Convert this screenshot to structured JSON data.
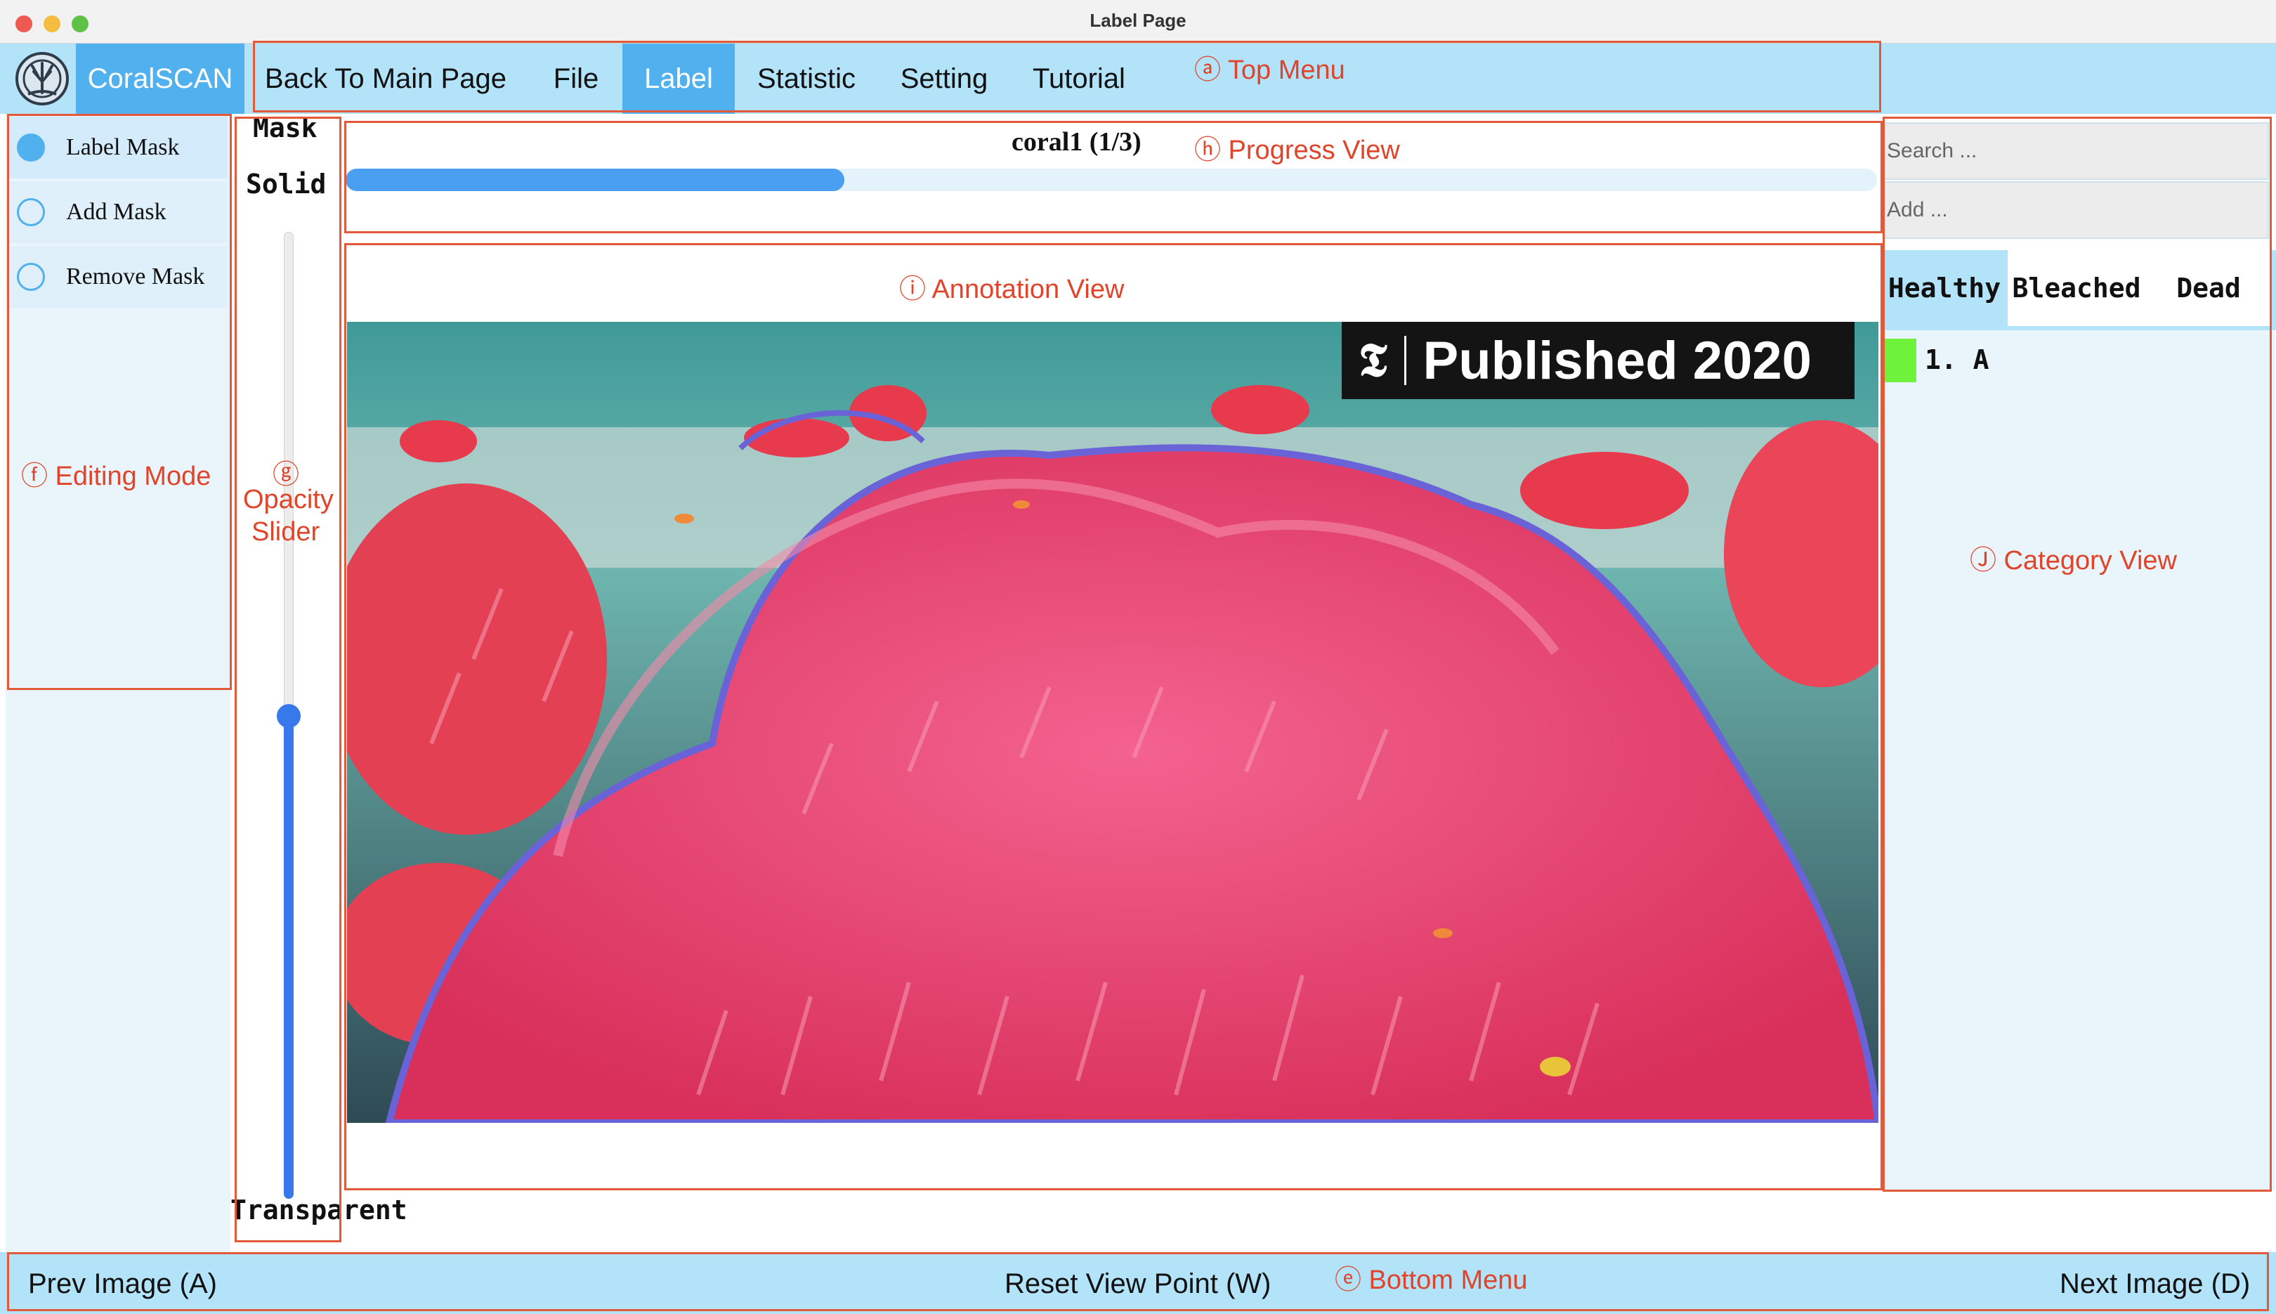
{
  "window": {
    "title": "Label Page",
    "traffic_lights": [
      "#ee5a52",
      "#f5bd3f",
      "#5fc146"
    ]
  },
  "top_menu": {
    "brand": "CoralSCAN",
    "items": [
      {
        "label": "Back To Main Page",
        "active": false
      },
      {
        "label": "File",
        "active": false
      },
      {
        "label": "Label",
        "active": true
      },
      {
        "label": "Statistic",
        "active": false
      },
      {
        "label": "Setting",
        "active": false
      },
      {
        "label": "Tutorial",
        "active": false
      }
    ]
  },
  "editing_mode": {
    "options": [
      {
        "label": "Label Mask",
        "selected": true
      },
      {
        "label": "Add Mask",
        "selected": false
      },
      {
        "label": "Remove Mask",
        "selected": false
      }
    ]
  },
  "opacity_slider": {
    "title": "Mask",
    "top_label": "Solid",
    "bottom_label": "Transparent",
    "value": 0.5
  },
  "progress": {
    "text": "coral1 (1/3)",
    "fraction": 0.333
  },
  "image": {
    "watermark_logo": "𝕿",
    "watermark_text": "Published 2020"
  },
  "category_view": {
    "search_placeholder": "Search ...",
    "add_placeholder": "Add ...",
    "tabs": [
      {
        "label": "Healthy",
        "active": false
      },
      {
        "label": "Bleached",
        "active": true
      },
      {
        "label": "Dead",
        "active": true
      }
    ],
    "items": [
      {
        "label": "1. A",
        "color": "#6ef23b"
      }
    ]
  },
  "bottom_menu": {
    "prev": "Prev Image (A)",
    "reset": "Reset View Point (W)",
    "next": "Next Image (D)"
  },
  "annotations": {
    "a": "ⓐ Top Menu",
    "e": "ⓔ Bottom Menu",
    "f": "ⓕ Editing Mode",
    "g1": "ⓖ",
    "g2": "Opacity",
    "g3": "Slider",
    "h": "ⓗ Progress View",
    "i": "ⓘ Annotation View",
    "j": "Ⓙ Category View"
  },
  "colors": {
    "accent": "#51b0ee",
    "bar_bg": "#b3e3f8",
    "annotation_red": "#e35a3a",
    "slider_blue": "#3778ea"
  }
}
